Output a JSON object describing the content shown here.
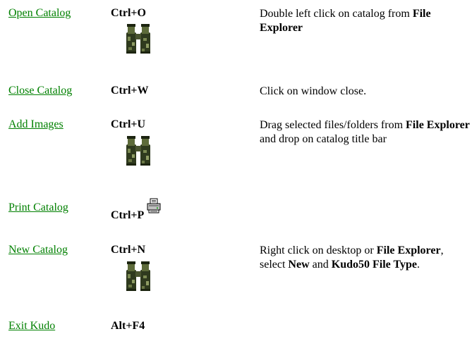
{
  "rows": [
    {
      "link": "Open Catalog",
      "shortcut": "Ctrl+O",
      "icon": "binoculars-icon",
      "desc": [
        {
          "t": "Double left click on catalog from "
        },
        {
          "t": "File Explorer",
          "b": true
        }
      ]
    },
    {
      "link": "Close Catalog",
      "shortcut": "Ctrl+W",
      "desc": [
        {
          "t": "Click on window close."
        }
      ]
    },
    {
      "link": "Add Images",
      "shortcut": "Ctrl+U",
      "icon": "binoculars-icon",
      "desc": [
        {
          "t": "Drag selected files/folders from "
        },
        {
          "t": "File Explorer",
          "b": true
        },
        {
          "t": " and drop on catalog title bar"
        }
      ]
    },
    {
      "link": "Print Catalog",
      "shortcut": "Ctrl+P",
      "icon": "printer-icon",
      "desc": []
    },
    {
      "link": "New Catalog",
      "shortcut": "Ctrl+N",
      "icon": "binoculars-icon",
      "desc": [
        {
          "t": "Right click on desktop or "
        },
        {
          "t": "File Explorer",
          "b": true
        },
        {
          "t": ", select "
        },
        {
          "t": "New",
          "b": true
        },
        {
          "t": " and "
        },
        {
          "t": "Kudo50 File Type",
          "b": true
        },
        {
          "t": "."
        }
      ]
    },
    {
      "link": "Exit Kudo",
      "shortcut": "Alt+F4",
      "desc": []
    }
  ],
  "colors": {
    "link": "#008000"
  }
}
